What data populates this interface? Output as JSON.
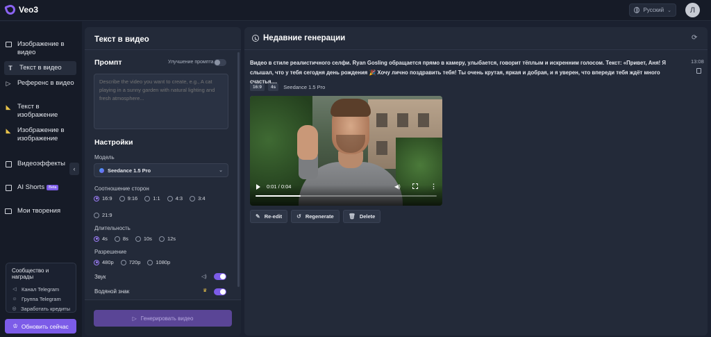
{
  "app": {
    "name": "Veo3"
  },
  "header": {
    "language": "Русский",
    "avatar_initial": "Л"
  },
  "sidebar": {
    "items": [
      {
        "label": "Изображение в видео",
        "icon": "image-icon"
      },
      {
        "label": "Текст в видео",
        "icon": "text-icon",
        "active": true
      },
      {
        "label": "Референс в видео",
        "icon": "play-icon"
      },
      {
        "label": "Текст в изображение",
        "icon": "banana-icon"
      },
      {
        "label": "Изображение в изображение",
        "icon": "banana-icon"
      },
      {
        "label": "Видеоэффекты",
        "icon": "film-icon"
      },
      {
        "label": "AI Shorts",
        "icon": "film-icon",
        "badge": "Beta"
      },
      {
        "label": "Мои творения",
        "icon": "folder-icon"
      }
    ],
    "community": {
      "title": "Сообщество и награды",
      "items": [
        {
          "label": "Канал Telegram",
          "icon": "megaphone-icon"
        },
        {
          "label": "Группа Telegram",
          "icon": "users-icon"
        },
        {
          "label": "Заработать кредиты",
          "icon": "coins-icon"
        }
      ]
    },
    "upgrade_label": "Обновить сейчас"
  },
  "form": {
    "title": "Текст в видео",
    "prompt_title": "Промпт",
    "enhance_label": "Улучшение промпта",
    "enhance_on": false,
    "prompt_placeholder": "Describe the video you want to create, e.g., A cat playing in a sunny garden with natural lighting and fresh atmosphere...",
    "settings_title": "Настройки",
    "model_label": "Модель",
    "model_value": "Seedance 1.5 Pro",
    "aspect_label": "Соотношение сторон",
    "aspect_options": [
      "16:9",
      "9:16",
      "1:1",
      "4:3",
      "3:4",
      "21:9"
    ],
    "aspect_selected": "16:9",
    "duration_label": "Длительность",
    "duration_options": [
      "4s",
      "8s",
      "10s",
      "12s"
    ],
    "duration_selected": "4s",
    "resolution_label": "Разрешение",
    "resolution_options": [
      "480p",
      "720p",
      "1080p"
    ],
    "resolution_selected": "480p",
    "sound_label": "Звук",
    "sound_on": true,
    "watermark_label": "Водяной знак",
    "watermark_on": true,
    "generate_label": "Генерировать видео"
  },
  "recent": {
    "title": "Недавние генерации",
    "items": [
      {
        "prompt_line1": "Видео в стиле реалистичного селфи. Ryan Gosling обращается прямо в камеру, улыбается, говорит тёплым и искренним голосом. Текст: «Привет, Аня! Я",
        "prompt_line2": "слышал, что у тебя сегодня день рождения 🎉 Хочу лично поздравить тебя! Ты очень крутая, яркая и добрая, и я уверен, что впереди тебя ждёт много счастья,...",
        "time": "13:08",
        "tags": [
          "16:9",
          "4s"
        ],
        "model": "Seedance 1.5 Pro",
        "video": {
          "time": "0:01 / 0:04",
          "progress": 0.25
        },
        "actions": [
          {
            "label": "Re-edit",
            "icon": "edit-icon"
          },
          {
            "label": "Regenerate",
            "icon": "regenerate-icon"
          },
          {
            "label": "Delete",
            "icon": "trash-icon"
          }
        ]
      }
    ]
  }
}
